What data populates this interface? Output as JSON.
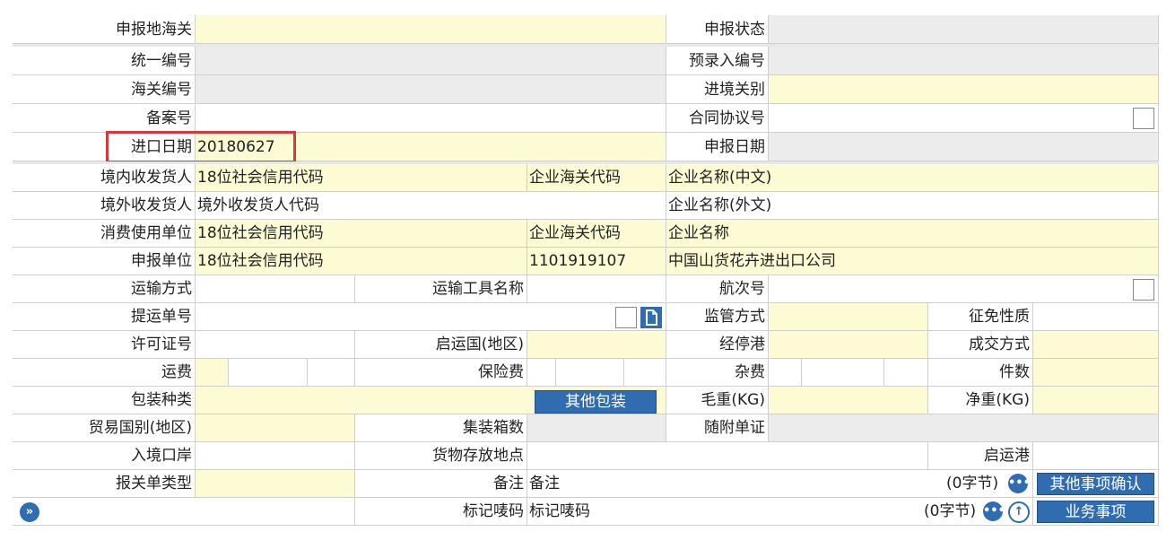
{
  "rows": {
    "r1": {
      "label_a": "申报地海关",
      "label_b": "申报状态"
    },
    "r2": {
      "label_a": "统一编号",
      "label_b": "预录入编号"
    },
    "r3": {
      "label_a": "海关编号",
      "label_b": "进境关别"
    },
    "r4": {
      "label_a": "备案号",
      "label_b": "合同协议号"
    },
    "r5": {
      "label_a": "进口日期",
      "value_a": "20180627",
      "label_b": "申报日期"
    },
    "r6": {
      "label": "境内收发货人",
      "code": "18位社会信用代码",
      "label2": "企业海关代码",
      "name": "企业名称(中文)"
    },
    "r7": {
      "label": "境外收发货人",
      "code": "境外收发货人代码",
      "name": "企业名称(外文)"
    },
    "r8": {
      "label": "消费使用单位",
      "code": "18位社会信用代码",
      "label2": "企业海关代码",
      "name": "企业名称"
    },
    "r9": {
      "label": "申报单位",
      "code": "18位社会信用代码",
      "customs_code": "1101919107",
      "name": "中国山货花卉进出口公司"
    },
    "r10": {
      "l1": "运输方式",
      "l2": "运输工具名称",
      "l3": "航次号"
    },
    "r11": {
      "l1": "提运单号",
      "l2": "监管方式",
      "l3": "征免性质"
    },
    "r12": {
      "l1": "许可证号",
      "l2": "启运国(地区)",
      "l3": "经停港",
      "l4": "成交方式"
    },
    "r13": {
      "l1": "运费",
      "l2": "保险费",
      "l3": "杂费",
      "l4": "件数"
    },
    "r14": {
      "l1": "包装种类",
      "btn": "其他包装",
      "l2": "毛重(KG)",
      "l3": "净重(KG)"
    },
    "r15": {
      "l1": "贸易国别(地区)",
      "l2": "集装箱数",
      "l3": "随附单证"
    },
    "r16": {
      "l1": "入境口岸",
      "l2": "货物存放地点",
      "l3": "启运港"
    },
    "r17": {
      "l1": "报关单类型",
      "l2": "备注",
      "v2": "备注",
      "count": "(0字节)",
      "btn": "其他事项确认"
    },
    "r18": {
      "l2": "标记唛码",
      "v2": "标记唛码",
      "count": "(0字节)",
      "btn": "业务事项"
    }
  },
  "icons": {
    "more": "•••",
    "up": "↑",
    "expand": "»",
    "doc": "doc-icon"
  }
}
